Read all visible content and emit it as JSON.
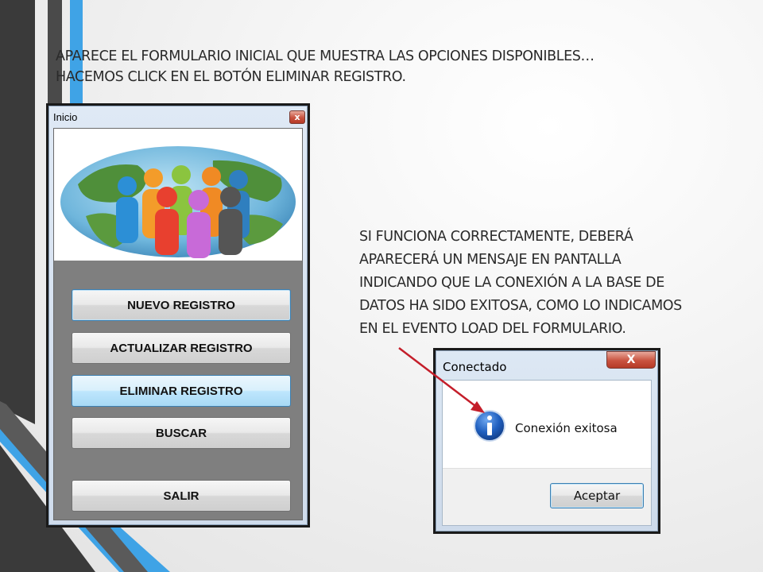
{
  "slide": {
    "intro_lines": [
      "APARECE EL FORMULARIO INICIAL QUE MUESTRA LAS OPCIONES DISPONIBLES…",
      "HACEMOS CLICK EN EL BOTÓN ELIMINAR REGISTRO."
    ],
    "explanation_lines": [
      "SI FUNCIONA CORRECTAMENTE,  DEBERÁ",
      "APARECERÁ UN MENSAJE EN PANTALLA",
      "INDICANDO QUE LA CONEXIÓN A LA BASE DE",
      "DATOS HA SIDO EXITOSA, COMO LO INDICAMOS",
      "EN EL EVENTO LOAD DEL FORMULARIO."
    ]
  },
  "inicio_window": {
    "title": "Inicio",
    "close_glyph": "x",
    "buttons": [
      {
        "label": "NUEVO REGISTRO"
      },
      {
        "label": "ACTUALIZAR REGISTRO"
      },
      {
        "label": "ELIMINAR REGISTRO"
      },
      {
        "label": "BUSCAR"
      },
      {
        "label": "SALIR"
      }
    ]
  },
  "message_dialog": {
    "title": "Conectado",
    "close_glyph": "X",
    "icon": "information-icon",
    "message": "Conexión exitosa",
    "ok_label": "Aceptar"
  },
  "colors": {
    "accent_blue": "#3fa3e6",
    "dark_stripe": "#3a3a3a",
    "arrow": "#c41e2a",
    "info_icon": "#1f5fbf"
  }
}
